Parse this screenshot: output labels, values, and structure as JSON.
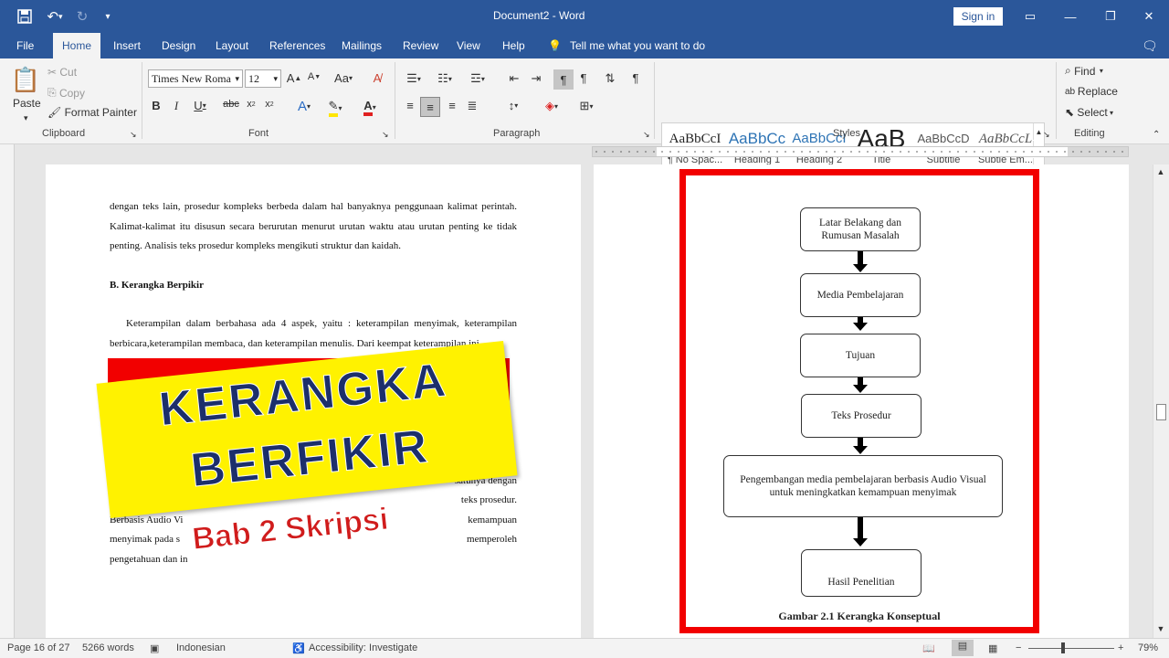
{
  "titlebar": {
    "title": "Document2  -  Word",
    "signin": "Sign in",
    "save_icon": "save-icon",
    "undo_icon": "undo-icon",
    "redo_icon": "redo-icon",
    "customize_icon": "customize-qat-icon"
  },
  "tabs": [
    "File",
    "Home",
    "Insert",
    "Design",
    "Layout",
    "References",
    "Mailings",
    "Review",
    "View",
    "Help"
  ],
  "tell_me": "Tell me what you want to do",
  "clipboard": {
    "paste": "Paste",
    "cut": "Cut",
    "copy": "Copy",
    "format_painter": "Format Painter",
    "label": "Clipboard"
  },
  "font": {
    "name": "Times New Roma",
    "size": "12",
    "label": "Font"
  },
  "paragraph": {
    "label": "Paragraph"
  },
  "styles": {
    "label": "Styles",
    "items": [
      {
        "preview": "AaBbCcI",
        "name": "¶ No Spac..."
      },
      {
        "preview": "AaBbCc",
        "name": "Heading 1"
      },
      {
        "preview": "AaBbCcI",
        "name": "Heading 2"
      },
      {
        "preview": "AaB",
        "name": "Title"
      },
      {
        "preview": "AaBbCcD",
        "name": "Subtitle"
      },
      {
        "preview": "AaBbCcL",
        "name": "Subtle Em..."
      }
    ]
  },
  "editing": {
    "find": "Find",
    "replace": "Replace",
    "select": "Select",
    "label": "Editing"
  },
  "left_page": {
    "para1": "dengan teks lain, prosedur kompleks berbeda dalam hal banyaknya penggunaan kalimat perintah. Kalimat-kalimat itu disusun secara berurutan menurut urutan waktu atau urutan penting ke tidak penting. Analisis teks prosedur kompleks mengikuti struktur dan kaidah.",
    "heading": "B.  Kerangka Berpikir",
    "para2": "Keterampilan dalam berbahasa ada 4 aspek, yaitu : keterampilan menyimak, keterampilan berbicara,keterampilan membaca, dan keterampilan menulis. Dari keempat keterampilan ini,",
    "frag_right": [
      "satunya dengan",
      "teks prosedur.",
      "kemampuan",
      "memperoleh"
    ],
    "frag_left": [
      "Berbasis Audio Vi",
      "menyimak pada s",
      "pengetahuan dan in"
    ]
  },
  "banner": {
    "line1": "KERANGKA",
    "line2": "BERFIKIR",
    "subtitle": "Bab 2 Skripsi"
  },
  "flowchart": {
    "boxes": [
      "Latar Belakang dan Rumusan Masalah",
      "Media Pembelajaran",
      "Tujuan",
      "Teks Prosedur",
      "Pengembangan media pembelajaran berbasis Audio Visual untuk meningkatkan kemampuan menyimak",
      "Hasil Penelitian"
    ],
    "caption": "Gambar 2.1 Kerangka Konseptual"
  },
  "status": {
    "page": "Page 16 of 27",
    "words": "5266 words",
    "language": "Indonesian",
    "accessibility": "Accessibility: Investigate",
    "zoom": "79%"
  },
  "colors": {
    "accent": "#2b579a",
    "frame_red": "#f20000",
    "banner_yellow": "#fff200"
  }
}
